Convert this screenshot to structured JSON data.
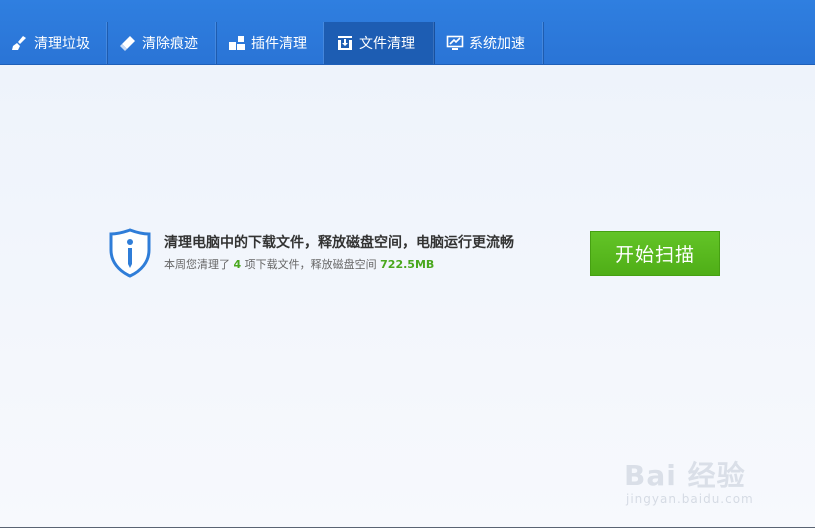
{
  "tabs": [
    {
      "label": "清理垃圾",
      "icon": "broom-icon"
    },
    {
      "label": "清除痕迹",
      "icon": "eraser-icon"
    },
    {
      "label": "插件清理",
      "icon": "plugin-icon"
    },
    {
      "label": "文件清理",
      "icon": "download-box-icon",
      "active": true
    },
    {
      "label": "系统加速",
      "icon": "monitor-speed-icon"
    }
  ],
  "main": {
    "headline": "清理电脑中的下载文件，释放磁盘空间，电脑运行更流畅",
    "sub_prefix": "本周您清理了",
    "sub_count": "4",
    "sub_mid": "项下载文件，释放磁盘空间",
    "sub_size": "722.5MB",
    "scan_button": "开始扫描"
  },
  "watermark": {
    "logo_text": "Bai  经验",
    "url": "jingyan.baidu.com"
  },
  "colors": {
    "header_blue": "#2a74d6",
    "active_tab": "#1d5db3",
    "scan_green": "#56b81c",
    "highlight_green": "#4aa81e"
  }
}
